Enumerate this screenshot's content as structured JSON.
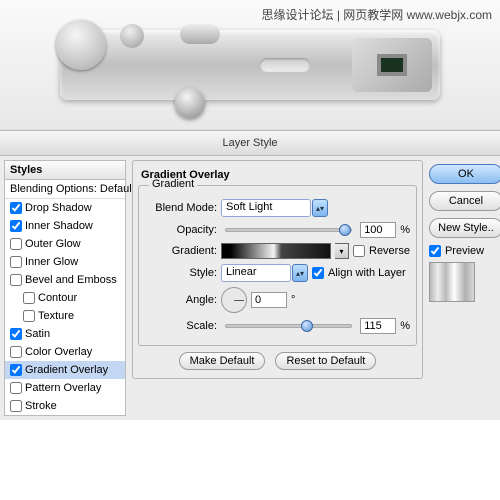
{
  "watermark": "思缘设计论坛 | 网页教学网\nwww.webjx.com",
  "dialog_title": "Layer Style",
  "styles_header": "Styles",
  "blending_header": "Blending Options: Default",
  "effects": [
    {
      "label": "Drop Shadow",
      "checked": true
    },
    {
      "label": "Inner Shadow",
      "checked": true
    },
    {
      "label": "Outer Glow",
      "checked": false
    },
    {
      "label": "Inner Glow",
      "checked": false
    },
    {
      "label": "Bevel and Emboss",
      "checked": false
    },
    {
      "label": "Contour",
      "checked": false,
      "sub": true
    },
    {
      "label": "Texture",
      "checked": false,
      "sub": true
    },
    {
      "label": "Satin",
      "checked": true
    },
    {
      "label": "Color Overlay",
      "checked": false
    },
    {
      "label": "Gradient Overlay",
      "checked": true,
      "selected": true
    },
    {
      "label": "Pattern Overlay",
      "checked": false
    },
    {
      "label": "Stroke",
      "checked": false
    }
  ],
  "panel_title": "Gradient Overlay",
  "group_title": "Gradient",
  "labels": {
    "blend_mode": "Blend Mode:",
    "opacity": "Opacity:",
    "gradient": "Gradient:",
    "style": "Style:",
    "angle": "Angle:",
    "scale": "Scale:",
    "reverse": "Reverse",
    "align": "Align with Layer",
    "pct": "%",
    "deg": "°",
    "make_default": "Make Default",
    "reset_default": "Reset to Default"
  },
  "values": {
    "blend_mode": "Soft Light",
    "opacity": "100",
    "style": "Linear",
    "reverse": false,
    "align": true,
    "angle": "0",
    "scale": "115"
  },
  "buttons": {
    "ok": "OK",
    "cancel": "Cancel",
    "new_style": "New Style..",
    "preview": "Preview"
  },
  "preview_checked": true
}
